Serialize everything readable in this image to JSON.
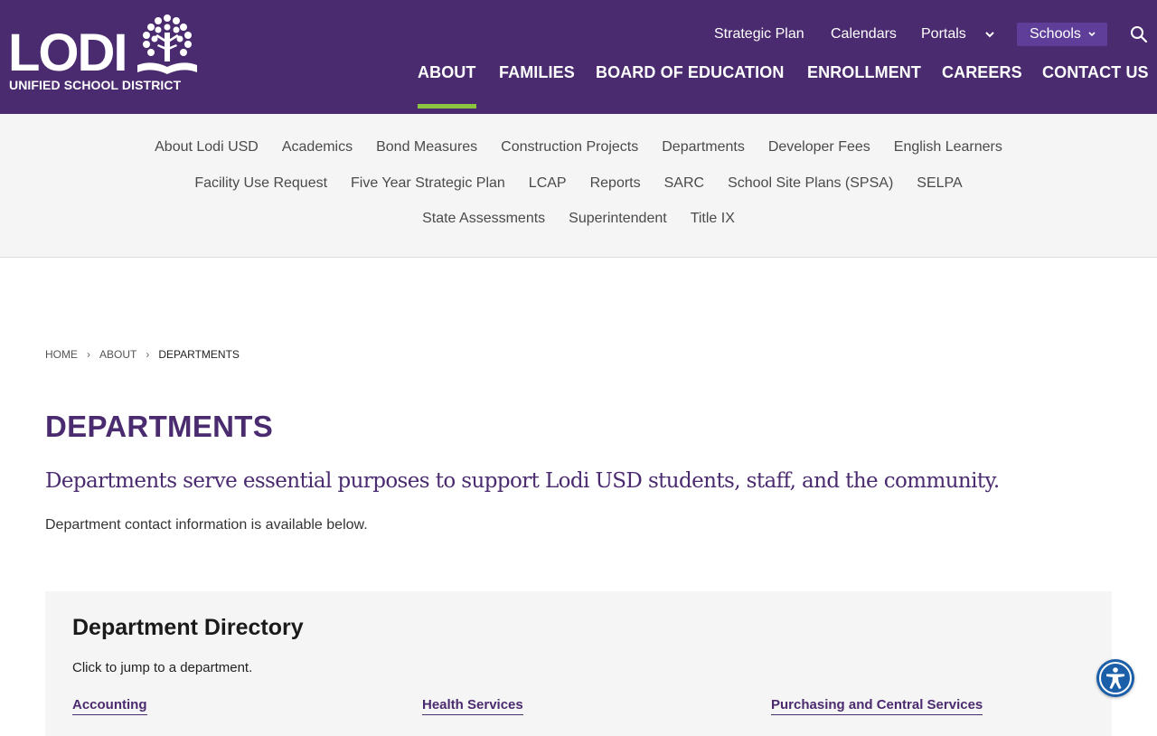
{
  "colors": {
    "header_bg": "#4b2b6f",
    "accent_purple": "#5e3e99",
    "active_underline": "#8cc63f",
    "subnav_bg": "#f5f5f5",
    "accessibility_blue": "#1a5fa8"
  },
  "logo": {
    "wordmark": "LODI",
    "subtitle": "UNIFIED SCHOOL DISTRICT",
    "icon": "tree-book-icon"
  },
  "utility_nav": {
    "strategic_plan": "Strategic Plan",
    "calendars": "Calendars",
    "portals": "Portals",
    "schools": "Schools",
    "search_icon": "search-icon"
  },
  "main_nav": {
    "about": "ABOUT",
    "families": "FAMILIES",
    "board": "BOARD OF EDUCATION",
    "enrollment": "ENROLLMENT",
    "careers": "CAREERS",
    "contact": "CONTACT US",
    "active": "ABOUT"
  },
  "sub_nav": {
    "row1": [
      "About Lodi USD",
      "Academics",
      "Bond Measures",
      "Construction Projects",
      "Departments",
      "Developer Fees",
      "English Learners"
    ],
    "row2": [
      "Facility Use Request",
      "Five Year Strategic Plan",
      "LCAP",
      "Reports",
      "SARC",
      "School Site Plans (SPSA)",
      "SELPA"
    ],
    "row3": [
      "State Assessments",
      "Superintendent",
      "Title IX"
    ]
  },
  "breadcrumb": {
    "home": "HOME",
    "about": "ABOUT",
    "current": "DEPARTMENTS"
  },
  "page": {
    "title": "DEPARTMENTS",
    "intro": "Departments serve essential purposes to support Lodi USD students, staff, and the community.",
    "body": "Department contact information is available below."
  },
  "directory": {
    "title": "Department Directory",
    "hint": "Click to jump to a department.",
    "links": [
      "Accounting",
      "Health Services",
      "Purchasing and Central Services"
    ]
  },
  "accessibility": {
    "icon": "accessibility-icon"
  }
}
